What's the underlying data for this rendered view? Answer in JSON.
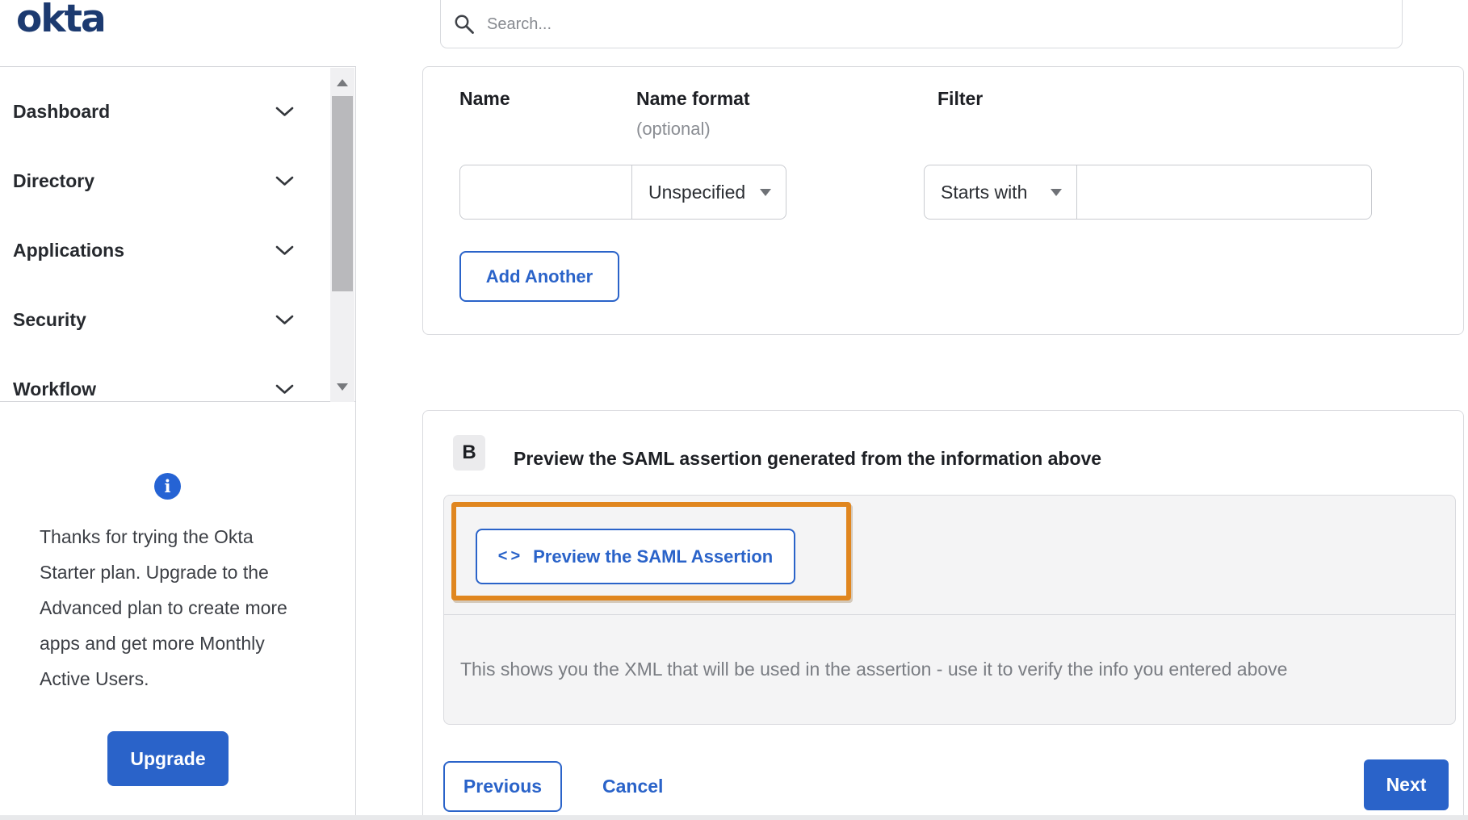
{
  "brand": {
    "logo_text": "okta"
  },
  "header": {
    "search_placeholder": "Search..."
  },
  "sidebar": {
    "items": [
      {
        "label": "Dashboard"
      },
      {
        "label": "Directory"
      },
      {
        "label": "Applications"
      },
      {
        "label": "Security"
      },
      {
        "label": "Workflow"
      }
    ]
  },
  "upgrade_panel": {
    "message": "Thanks for trying the Okta Starter plan. Upgrade to the Advanced plan to create more apps and get more Monthly Active Users.",
    "button_label": "Upgrade"
  },
  "attribute_form": {
    "columns": [
      {
        "label": "Name",
        "sublabel": ""
      },
      {
        "label": "Name format",
        "sublabel": "(optional)"
      },
      {
        "label": "Filter",
        "sublabel": ""
      }
    ],
    "name_value": "",
    "name_format_selected": "Unspecified",
    "filter_type_selected": "Starts with",
    "filter_value": "",
    "add_another_label": "Add Another"
  },
  "preview_section": {
    "badge": "B",
    "heading": "Preview the SAML assertion generated from the information above",
    "code_icon": "<>",
    "preview_button_label": "Preview the SAML Assertion",
    "description": "This shows you the XML that will be used in the assertion - use it to verify the info you entered above"
  },
  "footer": {
    "previous_label": "Previous",
    "cancel_label": "Cancel",
    "next_label": "Next"
  },
  "icons": {
    "search-icon": "magnifier",
    "chevron-down-icon": "chevron-down",
    "info-icon": "i",
    "code-icon": "<>",
    "scroll-up-icon": "triangle-up",
    "scroll-down-icon": "triangle-down",
    "dropdown-arrow-icon": "triangle-down"
  },
  "colors": {
    "accent_blue": "#2a63c9",
    "logo_navy": "#1c3a70",
    "highlight_orange": "#e0861f",
    "panel_gray": "#f4f4f5"
  }
}
